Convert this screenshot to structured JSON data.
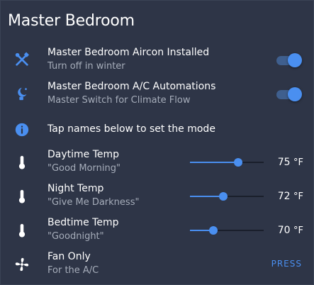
{
  "card": {
    "title": "Master Bedroom"
  },
  "colors": {
    "accent": "#4a8ff0",
    "card_bg": "#2e3547",
    "text": "#ffffff",
    "secondary_text": "#a6adba"
  },
  "entities": [
    {
      "name": "Master Bedroom Aircon Installed",
      "secondary": "Turn off in winter",
      "icon": "tools-icon",
      "toggle_on": true
    },
    {
      "name": "Master Bedroom A/C Automations",
      "secondary": "Master Switch for Climate Flow",
      "icon": "robot-icon",
      "toggle_on": true
    },
    {
      "name": "Tap names below to set the mode",
      "icon": "info-icon"
    },
    {
      "name": "Daytime Temp",
      "secondary": "\"Good Morning\"",
      "icon": "thermometer-icon",
      "value": "75",
      "unit": "°F",
      "slider_fraction": 0.65
    },
    {
      "name": "Night Temp",
      "secondary": "\"Give Me Darkness\"",
      "icon": "thermometer-icon",
      "value": "72",
      "unit": "°F",
      "slider_fraction": 0.45
    },
    {
      "name": "Bedtime Temp",
      "secondary": "\"Goodnight\"",
      "icon": "thermometer-icon",
      "value": "70",
      "unit": "°F",
      "slider_fraction": 0.32
    },
    {
      "name": "Fan Only",
      "secondary": "For the A/C",
      "icon": "fan-icon",
      "action_label": "PRESS"
    }
  ]
}
